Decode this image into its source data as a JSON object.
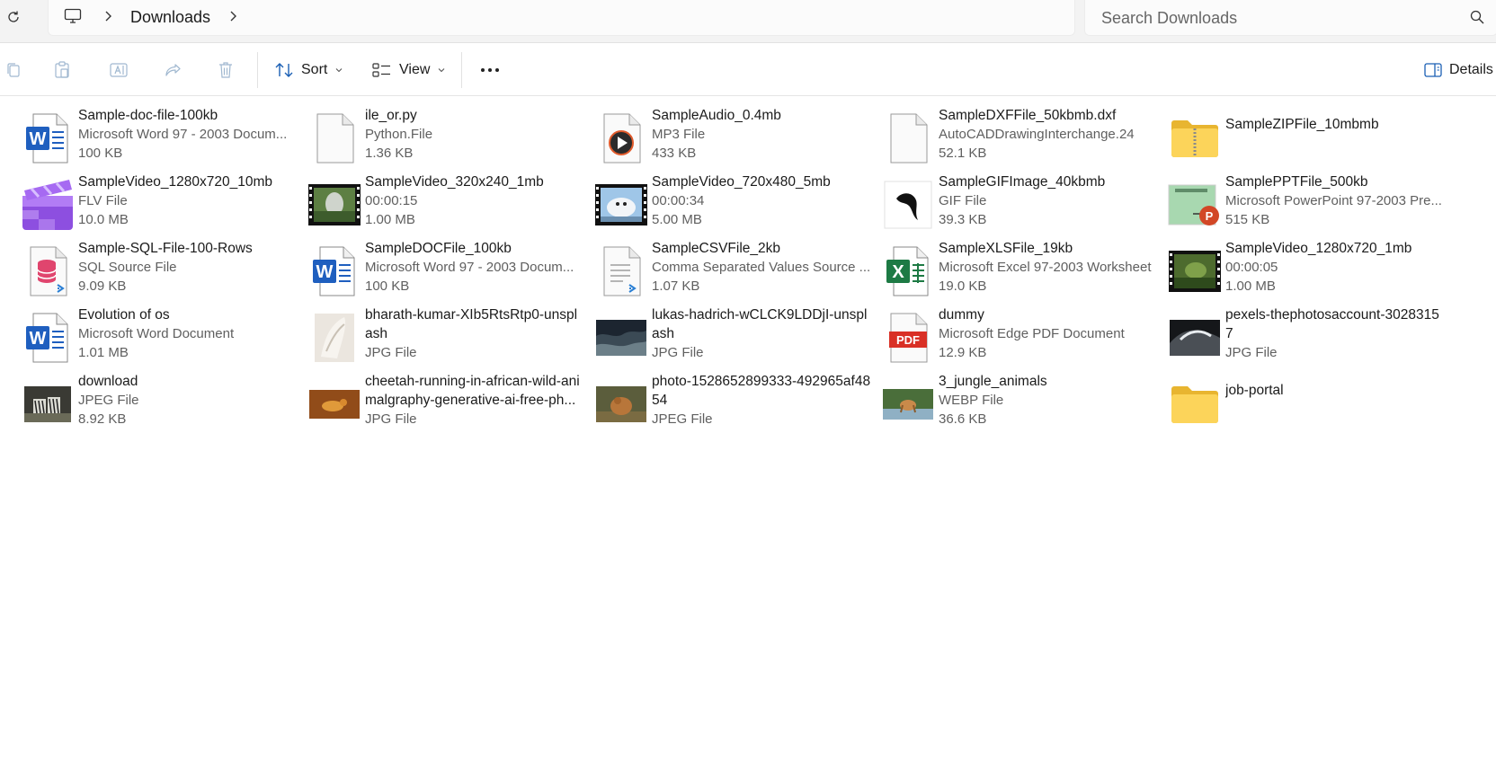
{
  "breadcrumb": {
    "location": "Downloads"
  },
  "search": {
    "placeholder": "Search Downloads"
  },
  "toolbar": {
    "sort_label": "Sort",
    "view_label": "View",
    "details_label": "Details"
  },
  "files": [
    {
      "name": "Sample-doc-file-100kb",
      "type": "Microsoft Word 97 - 2003 Docum...",
      "size": "100 KB",
      "icon": "word-doc-icon"
    },
    {
      "name": "ile_or.py",
      "type": "Python.File",
      "size": "1.36 KB",
      "icon": "blank-file-icon"
    },
    {
      "name": "SampleAudio_0.4mb",
      "type": "MP3 File",
      "size": "433 KB",
      "icon": "audio-file-icon"
    },
    {
      "name": "SampleDXFFile_50kbmb.dxf",
      "type": "AutoCADDrawingInterchange.24",
      "size": "52.1 KB",
      "icon": "blank-file-icon"
    },
    {
      "name": "SampleZIPFile_10mbmb",
      "type": "",
      "size": "",
      "icon": "zip-folder-icon"
    },
    {
      "name": "SampleVideo_1280x720_10mb",
      "type": "FLV File",
      "size": "10.0 MB",
      "icon": "clapperboard-icon"
    },
    {
      "name": "SampleVideo_320x240_1mb",
      "type": "00:00:15",
      "size": "1.00 MB",
      "icon": "video-thumbnail-icon"
    },
    {
      "name": "SampleVideo_720x480_5mb",
      "type": "00:00:34",
      "size": "5.00 MB",
      "icon": "video-thumbnail-icon"
    },
    {
      "name": "SampleGIFImage_40kbmb",
      "type": "GIF File",
      "size": "39.3 KB",
      "icon": "gif-thumbnail-icon"
    },
    {
      "name": "SamplePPTFile_500kb",
      "type": "Microsoft PowerPoint 97-2003 Pre...",
      "size": "515 KB",
      "icon": "powerpoint-icon"
    },
    {
      "name": "Sample-SQL-File-100-Rows",
      "type": "SQL Source File",
      "size": "9.09 KB",
      "icon": "sql-file-icon"
    },
    {
      "name": "SampleDOCFile_100kb",
      "type": "Microsoft Word 97 - 2003 Docum...",
      "size": "100 KB",
      "icon": "word-doc-icon"
    },
    {
      "name": "SampleCSVFile_2kb",
      "type": "Comma Separated Values Source ...",
      "size": "1.07 KB",
      "icon": "csv-file-icon"
    },
    {
      "name": "SampleXLSFile_19kb",
      "type": "Microsoft Excel 97-2003 Worksheet",
      "size": "19.0 KB",
      "icon": "excel-icon"
    },
    {
      "name": "SampleVideo_1280x720_1mb",
      "type": "00:00:05",
      "size": "1.00 MB",
      "icon": "video-thumbnail-icon"
    },
    {
      "name": "Evolution of os",
      "type": "Microsoft Word Document",
      "size": "1.01 MB",
      "icon": "word-doc-icon"
    },
    {
      "name": "bharath-kumar-XIb5RtsRtp0-unsplash",
      "type": "JPG File",
      "size": "",
      "icon": "photo-thumbnail-icon"
    },
    {
      "name": "lukas-hadrich-wCLCK9LDDjI-unsplash",
      "type": "JPG File",
      "size": "",
      "icon": "photo-thumbnail-icon"
    },
    {
      "name": "dummy",
      "type": "Microsoft Edge PDF Document",
      "size": "12.9 KB",
      "icon": "pdf-icon"
    },
    {
      "name": "pexels-thephotosaccount-30283157",
      "type": "JPG File",
      "size": "",
      "icon": "photo-thumbnail-icon"
    },
    {
      "name": "download",
      "type": "JPEG File",
      "size": "8.92 KB",
      "icon": "photo-thumbnail-icon"
    },
    {
      "name": "cheetah-running-in-african-wild-animalgraphy-generative-ai-free-ph...",
      "type": "JPG File",
      "size": "",
      "icon": "photo-thumbnail-icon"
    },
    {
      "name": "photo-1528652899333-492965af4854",
      "type": "JPEG File",
      "size": "",
      "icon": "photo-thumbnail-icon"
    },
    {
      "name": "3_jungle_animals",
      "type": "WEBP File",
      "size": "36.6 KB",
      "icon": "photo-thumbnail-icon"
    },
    {
      "name": "job-portal",
      "type": "",
      "size": "",
      "icon": "folder-icon"
    }
  ]
}
